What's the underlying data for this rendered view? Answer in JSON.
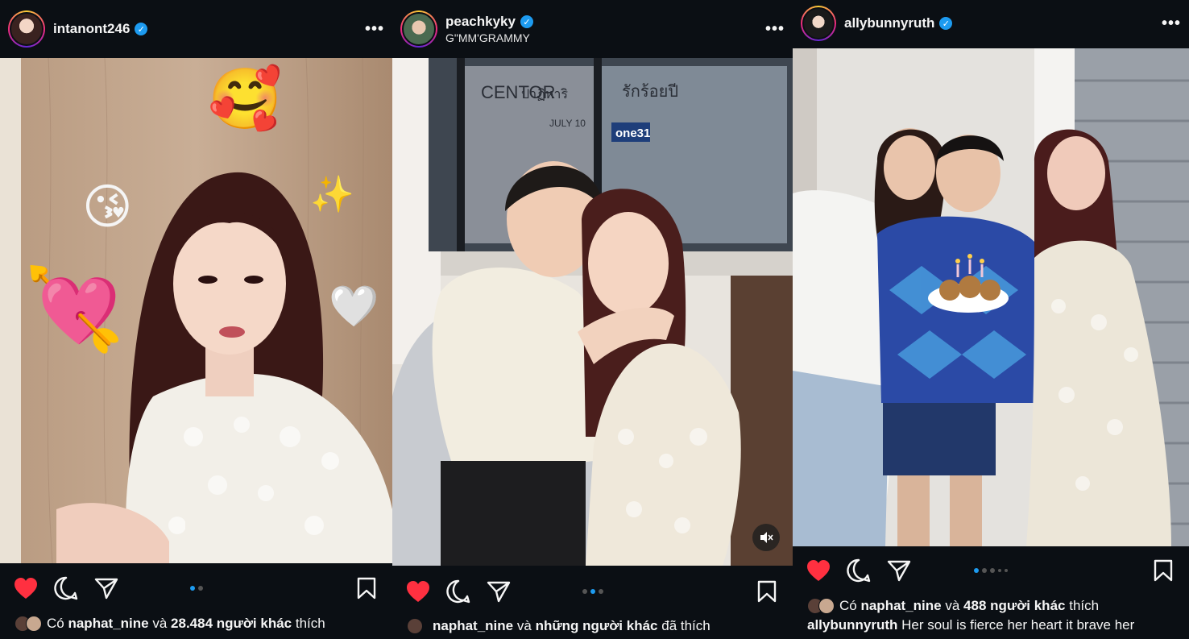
{
  "posts": [
    {
      "username": "intanont246",
      "subtitle": "",
      "verified_mark": "✓",
      "more": "•••",
      "likes_prefix": "Có",
      "likes_user": "naphat_nine",
      "likes_mid": "và",
      "likes_count": "28.484 người khác",
      "likes_suffix": "thích",
      "cut_text": "...",
      "dots": {
        "total": 2,
        "active": 0
      },
      "emojis": [
        "🥰",
        "😘",
        "💘",
        "🤍",
        "✨"
      ]
    },
    {
      "username": "peachkyky",
      "subtitle": "G\"MM'GRAMMY",
      "verified_mark": "✓",
      "more": "•••",
      "likes_user": "naphat_nine",
      "likes_mid": "và",
      "likes_count": "những người khác",
      "likes_suffix": "đã thích",
      "dots": {
        "total": 3,
        "active": 1
      },
      "store_text_1": "CENTOR",
      "store_text_2": "รักร้อยปี",
      "store_text_3": "ปาฏิหาริ",
      "store_text_4": "JULY 10",
      "store_text_5": "one31"
    },
    {
      "username": "allybunnyruth",
      "subtitle": "",
      "verified_mark": "✓",
      "more": "•••",
      "likes_prefix": "Có",
      "likes_user": "naphat_nine",
      "likes_mid": "và",
      "likes_count": "488 người khác",
      "likes_suffix": "thích",
      "caption_user": "allybunnyruth",
      "caption_text": "Her soul is fierce her heart it brave her",
      "dots": {
        "total": 5,
        "active": 0
      }
    }
  ],
  "colors": {
    "heart": "#ff3040",
    "verified": "#1d9bf0",
    "background": "#0b0f14"
  },
  "icons": [
    "heart-icon",
    "comment-icon",
    "share-icon",
    "bookmark-icon",
    "more-icon",
    "verified-icon",
    "mute-icon"
  ]
}
